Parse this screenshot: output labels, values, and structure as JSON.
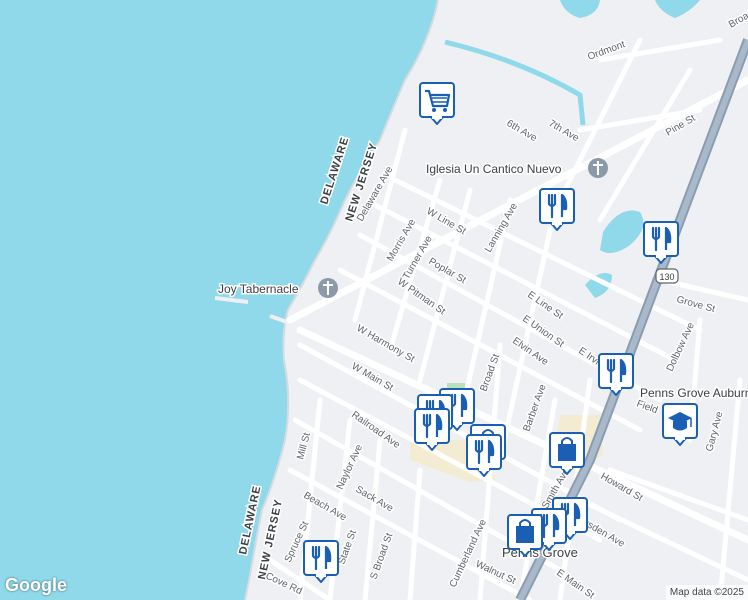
{
  "map": {
    "colors": {
      "water": "#8fd9ea",
      "land": "#eef0f3",
      "road": "#ffffff",
      "highway": "#a9b9c9",
      "marker": "#1a5fb4"
    },
    "state_labels": {
      "west_top": "DELAWARE",
      "east_top": "NEW JERSEY",
      "west_bottom": "DELAWARE",
      "east_bottom": "NEW JERSEY"
    },
    "places": {
      "joy_tabernacle": "Joy Tabernacle",
      "iglesia": "Iglesia Un Cantico Nuevo",
      "penns_grove": "Penns Grove",
      "penns_grove_auburn": "Penns Grove Auburn",
      "ordmont": "Ordmont"
    },
    "streets": {
      "delaware_ave": "Delaware Ave",
      "morris_ave": "Morris Ave",
      "turner_ave": "Turner Ave",
      "w_line_st": "W Line St",
      "poplar_st": "Poplar St",
      "w_pitman_st": "W Pitman St",
      "w_harmony_st": "W Harmony St",
      "w_main_st": "W Main St",
      "lanning_ave": "Lanning Ave",
      "sixth_ave": "6th Ave",
      "seventh_ave": "7th Ave",
      "pine_st": "Pine St",
      "e_line_st": "E Line St",
      "e_union_st": "E Union St",
      "elvin_ave": "Elvin Ave",
      "broad_st": "Broad St",
      "e_irvi": "E Irvi",
      "field": "Field",
      "grove_st": "Grove St",
      "dolbow_ave": "Dolbow Ave",
      "gary_ave": "Gary Ave",
      "barber_ave": "Barber Ave",
      "howard_st": "Howard St",
      "n_smith_ave": "N Smith Ave",
      "railroad_ave": "Railroad Ave",
      "naylor_ave": "Naylor Ave",
      "mill_st": "Mill St",
      "sack_ave": "Sack Ave",
      "beach_ave": "Beach Ave",
      "spruce_st": "Spruce St",
      "state_st": "State St",
      "s_broad_st": "S Broad St",
      "cumberland_ave": "Cumberland Ave",
      "walnut_st": "Walnut St",
      "e_main_st": "E Main St",
      "cove_rd": "Cove Rd",
      "marsden_ave": "rsden Ave",
      "broad_top": "Broad"
    },
    "highway_shield": "130",
    "markers": [
      {
        "type": "shopping-cart",
        "label": "grocery"
      },
      {
        "type": "restaurant",
        "label": "restaurant"
      },
      {
        "type": "restaurant",
        "label": "restaurant"
      },
      {
        "type": "restaurant",
        "label": "restaurant"
      },
      {
        "type": "school",
        "label": "school"
      },
      {
        "type": "restaurant",
        "label": "restaurant"
      },
      {
        "type": "restaurant",
        "label": "restaurant"
      },
      {
        "type": "restaurant",
        "label": "restaurant"
      },
      {
        "type": "shopping-bag",
        "label": "shopping"
      },
      {
        "type": "shopping-bag",
        "label": "shopping"
      },
      {
        "type": "restaurant",
        "label": "restaurant"
      },
      {
        "type": "restaurant",
        "label": "restaurant"
      },
      {
        "type": "shopping-bag",
        "label": "shopping"
      },
      {
        "type": "restaurant",
        "label": "restaurant"
      }
    ],
    "attribution": "Map data ©2025",
    "logo": "Google"
  }
}
